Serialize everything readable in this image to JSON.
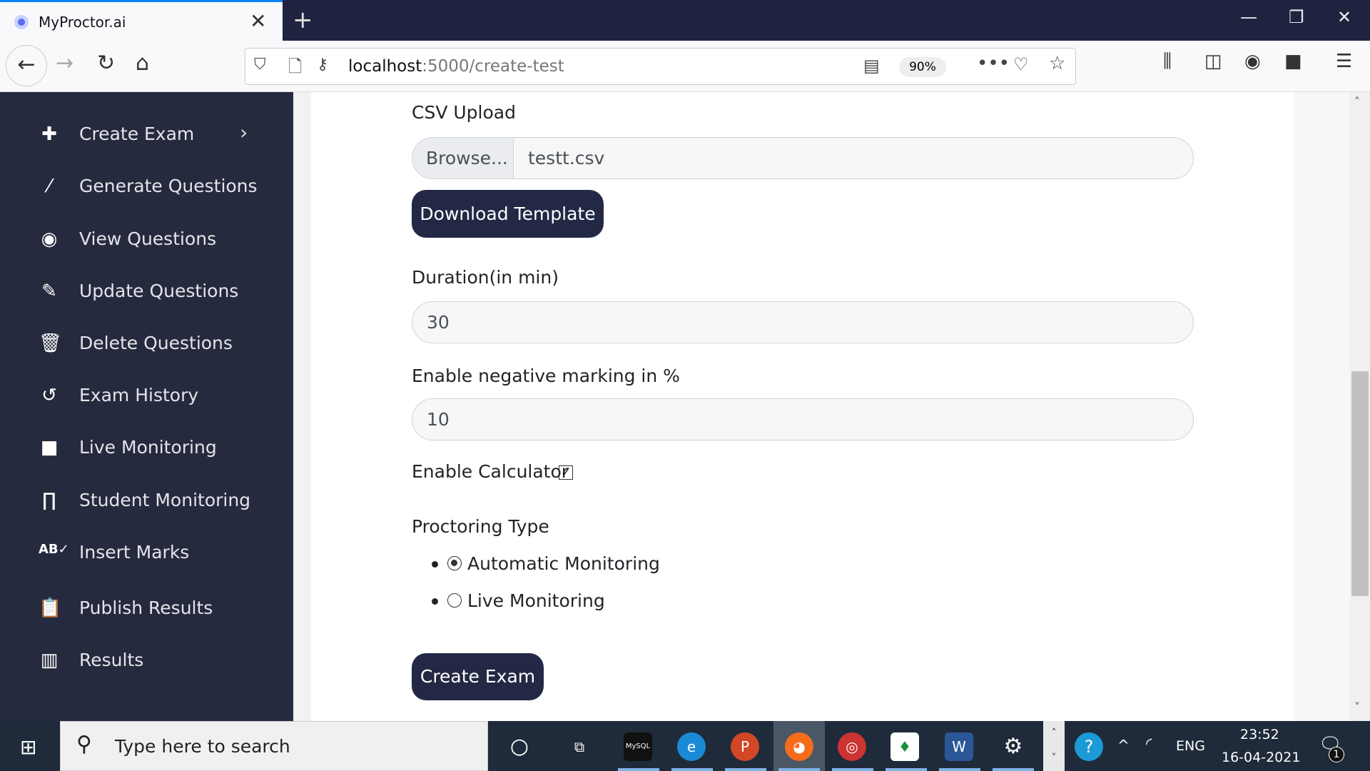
{
  "browser": {
    "tab_title": "MyProctor.ai",
    "url_host": "localhost",
    "url_path": ":5000/create-test",
    "zoom": "90%"
  },
  "sidebar": {
    "items": [
      {
        "label": "Create Exam",
        "icon": "plus-icon"
      },
      {
        "label": "Generate Questions",
        "icon": "magic-wand-icon"
      },
      {
        "label": "View Questions",
        "icon": "eye-icon"
      },
      {
        "label": "Update Questions",
        "icon": "edit-icon"
      },
      {
        "label": "Delete Questions",
        "icon": "trash-icon"
      },
      {
        "label": "Exam History",
        "icon": "history-icon"
      },
      {
        "label": "Live Monitoring",
        "icon": "video-icon"
      },
      {
        "label": "Student Monitoring",
        "icon": "binoculars-icon"
      },
      {
        "label": "Insert Marks",
        "icon": "spell-check-icon"
      },
      {
        "label": "Publish Results",
        "icon": "clipboard-check-icon"
      },
      {
        "label": "Results",
        "icon": "chart-icon"
      }
    ]
  },
  "form": {
    "csv_label": "CSV Upload",
    "browse_label": "Browse...",
    "csv_file": "testt.csv",
    "download_template": "Download Template",
    "duration_label": "Duration(in min)",
    "duration_value": "30",
    "negative_label": "Enable negative marking in %",
    "negative_value": "10",
    "calculator_label": "Enable Calculator",
    "calculator_checked": true,
    "proctoring_label": "Proctoring Type",
    "proctoring_options": [
      {
        "label": "Automatic Monitoring",
        "selected": true
      },
      {
        "label": "Live Monitoring",
        "selected": false
      }
    ],
    "submit": "Create Exam"
  },
  "taskbar": {
    "search_placeholder": "Type here to search",
    "time": "23:52",
    "date": "16-04-2021",
    "lang": "ENG",
    "notifications": "1"
  },
  "colors": {
    "sidebar": "#262a3e",
    "button": "#232944",
    "tab_accent": "#0a84ff"
  }
}
